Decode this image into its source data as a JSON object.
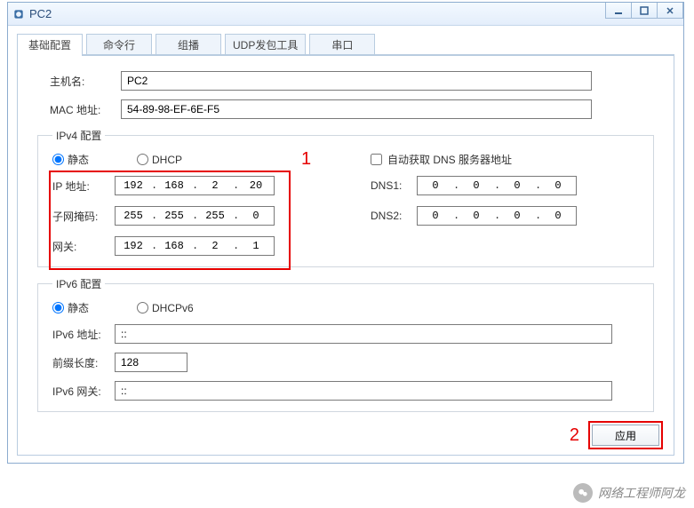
{
  "window": {
    "title": "PC2"
  },
  "tabs": [
    "基础配置",
    "命令行",
    "组播",
    "UDP发包工具",
    "串口"
  ],
  "basic": {
    "hostLabel": "主机名:",
    "hostValue": "PC2",
    "macLabel": "MAC 地址:",
    "macValue": "54-89-98-EF-6E-F5"
  },
  "ipv4": {
    "legend": "IPv4 配置",
    "radioStatic": "静态",
    "radioDhcp": "DHCP",
    "autoDns": "自动获取 DNS 服务器地址",
    "ipLabel": "IP 地址:",
    "ip": [
      "192",
      "168",
      "2",
      "20"
    ],
    "maskLabel": "子网掩码:",
    "mask": [
      "255",
      "255",
      "255",
      "0"
    ],
    "gwLabel": "网关:",
    "gw": [
      "192",
      "168",
      "2",
      "1"
    ],
    "dns1Label": "DNS1:",
    "dns1": [
      "0",
      "0",
      "0",
      "0"
    ],
    "dns2Label": "DNS2:",
    "dns2": [
      "0",
      "0",
      "0",
      "0"
    ]
  },
  "ipv6": {
    "legend": "IPv6 配置",
    "radioStatic": "静态",
    "radioDhcp": "DHCPv6",
    "addrLabel": "IPv6 地址:",
    "addrValue": "::",
    "prefixLabel": "前缀长度:",
    "prefixValue": "128",
    "gwLabel": "IPv6 网关:",
    "gwValue": "::"
  },
  "apply": "应用",
  "markers": {
    "one": "1",
    "two": "2"
  },
  "watermark": "网络工程师阿龙"
}
